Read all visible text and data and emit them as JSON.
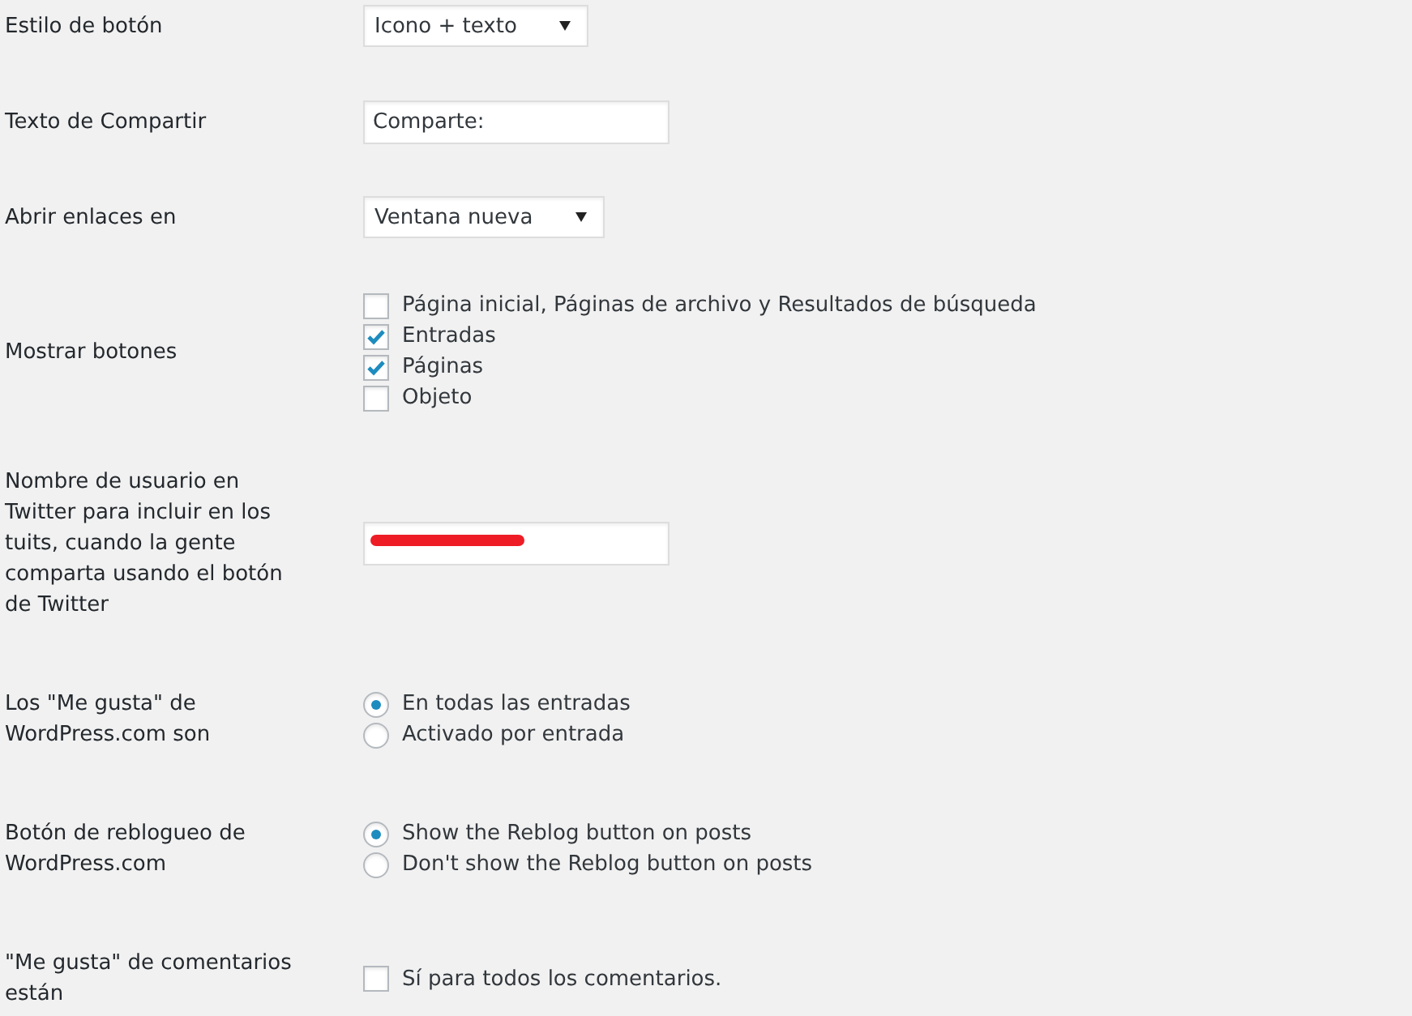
{
  "settings": [
    {
      "kind": "select",
      "label": "Estilo de botón",
      "value": "Icono + texto"
    },
    {
      "kind": "text",
      "label": "Texto de Compartir",
      "value": "Comparte:"
    },
    {
      "kind": "select",
      "label": "Abrir enlaces en",
      "value": "Ventana nueva"
    },
    {
      "kind": "checkboxes",
      "label": "Mostrar botones",
      "options": [
        {
          "label": "Página inicial, Páginas de archivo y Resultados de búsqueda",
          "checked": false
        },
        {
          "label": "Entradas",
          "checked": true
        },
        {
          "label": "Páginas",
          "checked": true
        },
        {
          "label": "Objeto",
          "checked": false
        }
      ]
    },
    {
      "kind": "redacted",
      "label": "Nombre de usuario en Twitter para incluir en los tuits, cuando la gente comparta usando el botón de Twitter"
    },
    {
      "kind": "radios",
      "label": "Los \"Me gusta\" de WordPress.com son",
      "options": [
        {
          "label": "En todas las entradas",
          "selected": true
        },
        {
          "label": "Activado por entrada",
          "selected": false
        }
      ]
    },
    {
      "kind": "radios",
      "label": "Botón de reblogueo de WordPress.com",
      "options": [
        {
          "label": "Show the Reblog button on posts",
          "selected": true
        },
        {
          "label": "Don't show the Reblog button on posts",
          "selected": false
        }
      ]
    },
    {
      "kind": "checkboxes",
      "label": "\"Me gusta\" de comentarios están",
      "options": [
        {
          "label": "Sí para todos los comentarios.",
          "checked": false
        }
      ]
    }
  ]
}
